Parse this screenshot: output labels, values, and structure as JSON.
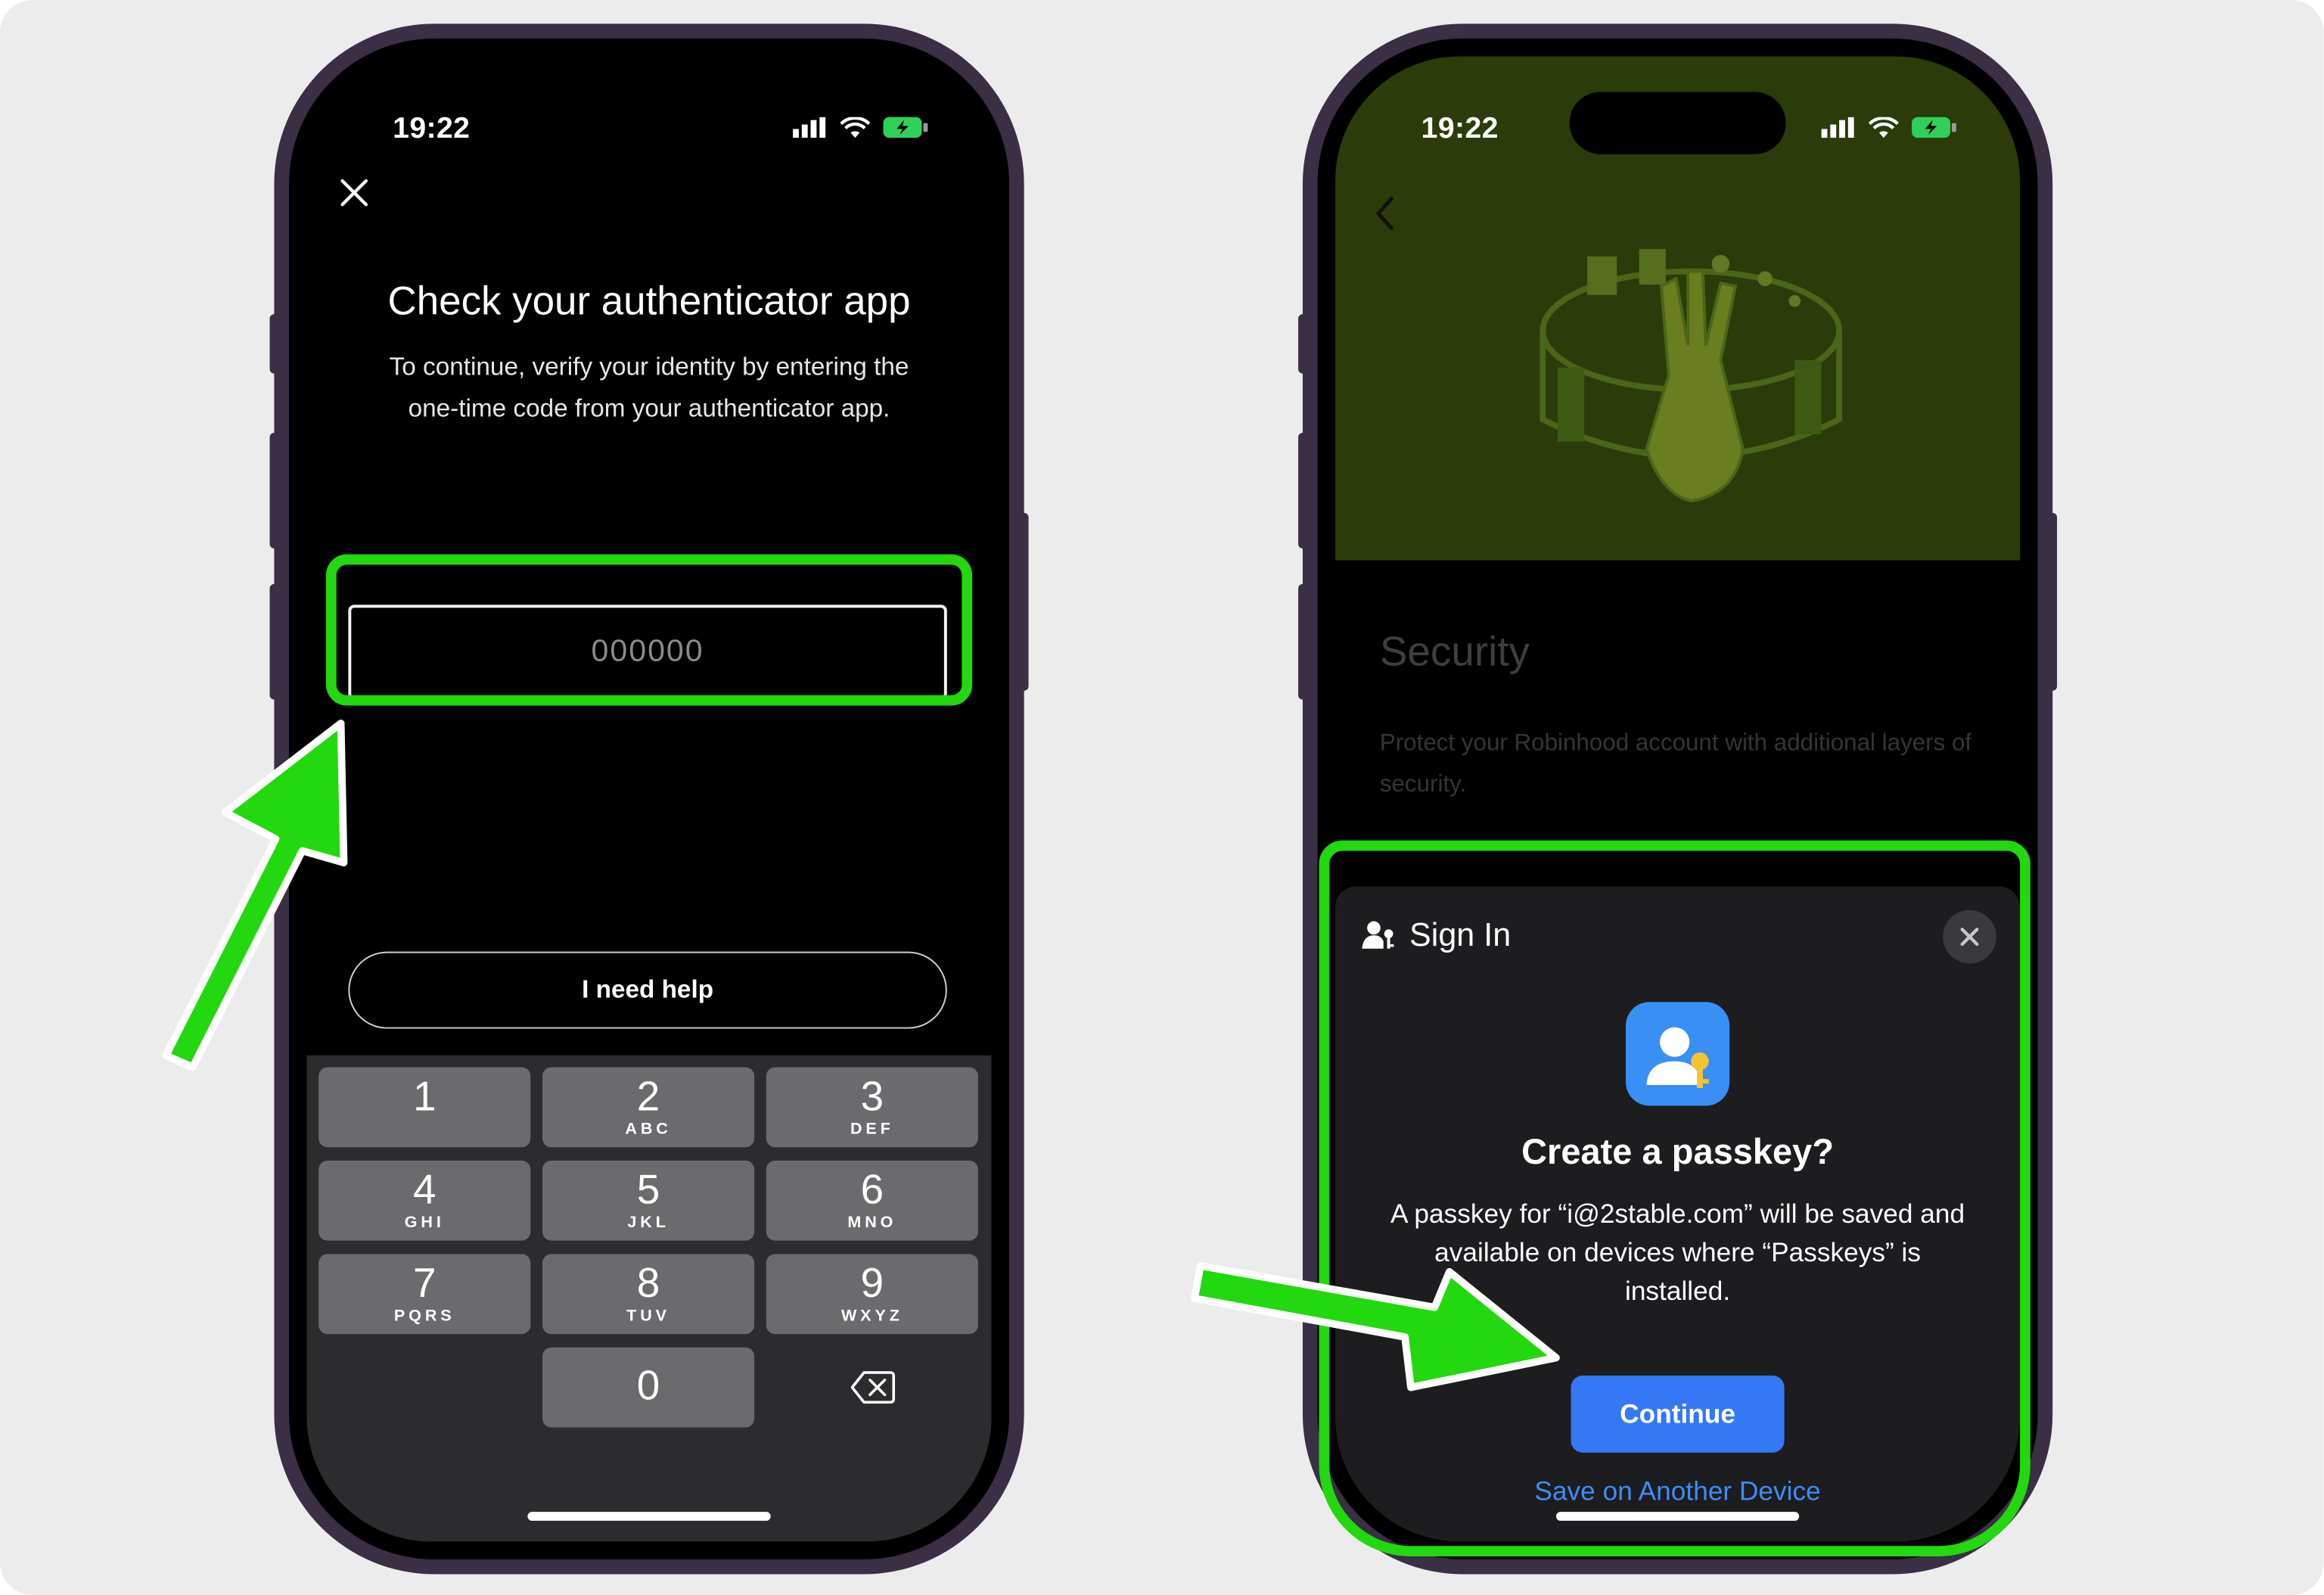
{
  "colors": {
    "highlight": "#22d80e",
    "continue": "#3478f6",
    "link": "#3f8cf6",
    "background": "#ececec"
  },
  "left_phone": {
    "status_time": "19:22",
    "close_icon": "close-icon",
    "title": "Check your authenticator app",
    "subtitle_line1": "To continue, verify your identity by entering the",
    "subtitle_line2": "one-time code from your authenticator app.",
    "code_placeholder": "000000",
    "help_label": "I need help",
    "keypad": [
      {
        "num": "1",
        "letters": ""
      },
      {
        "num": "2",
        "letters": "ABC"
      },
      {
        "num": "3",
        "letters": "DEF"
      },
      {
        "num": "4",
        "letters": "GHI"
      },
      {
        "num": "5",
        "letters": "JKL"
      },
      {
        "num": "6",
        "letters": "MNO"
      },
      {
        "num": "7",
        "letters": "PQRS"
      },
      {
        "num": "8",
        "letters": "TUV"
      },
      {
        "num": "9",
        "letters": "WXYZ"
      },
      {
        "num": "0",
        "letters": ""
      }
    ],
    "backspace_icon": "backspace-icon"
  },
  "right_phone": {
    "status_time": "19:22",
    "back_icon": "chevron-left-icon",
    "page_title": "Security",
    "page_subtitle": "Protect your Robinhood account with additional layers of security.",
    "sheet": {
      "title": "Sign In",
      "title_icon": "person-key-icon",
      "close_icon": "close-icon",
      "app_icon": "passkey-app-icon",
      "heading": "Create a passkey?",
      "body": "A passkey for “i@2stable.com” will be saved and available on devices where “Passkeys” is installed.",
      "continue_label": "Continue",
      "alt_label": "Save on Another Device"
    }
  }
}
